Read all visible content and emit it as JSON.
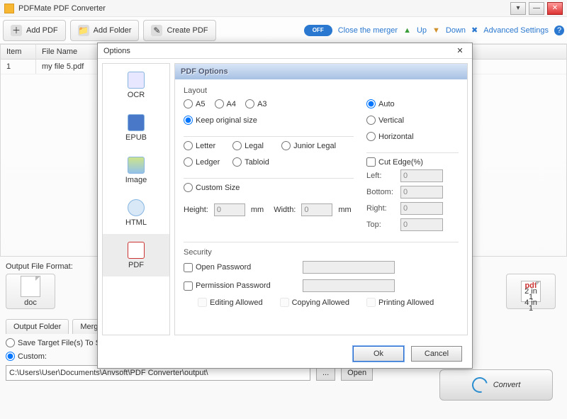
{
  "app": {
    "title": "PDFMate PDF Converter"
  },
  "toolbar": {
    "add_pdf": "Add PDF",
    "add_folder": "Add Folder",
    "create_pdf": "Create PDF",
    "merger_toggle": "OFF",
    "close_merger": "Close the merger",
    "up": "Up",
    "down": "Down",
    "advanced": "Advanced Settings"
  },
  "table": {
    "col_item": "Item",
    "col_file": "File Name",
    "rows": [
      {
        "item": "1",
        "file": "my file  5.pdf"
      }
    ]
  },
  "output_format": {
    "label": "Output File Format:",
    "doc": "doc",
    "pdf_badge": "pdf",
    "pdf_sub1": "2 in 1",
    "pdf_sub2": "4 in 1"
  },
  "output_folder": {
    "tab1": "Output Folder",
    "tab2": "Merge",
    "save_source": "Save Target File(s) To S",
    "custom": "Custom:",
    "path": "C:\\Users\\User\\Documents\\Anvsoft\\PDF Converter\\output\\",
    "browse": "...",
    "open": "Open"
  },
  "convert": "Convert",
  "dialog": {
    "title": "Options",
    "sidebar": {
      "ocr": "OCR",
      "epub": "EPUB",
      "image": "Image",
      "html": "HTML",
      "pdf": "PDF"
    },
    "header": "PDF Options",
    "layout": {
      "label": "Layout",
      "a5": "A5",
      "a4": "A4",
      "a3": "A3",
      "keep": "Keep original size",
      "letter": "Letter",
      "legal": "Legal",
      "junior": "Junior Legal",
      "ledger": "Ledger",
      "tabloid": "Tabloid",
      "custom": "Custom Size",
      "height": "Height:",
      "width": "Width:",
      "h_val": "0",
      "w_val": "0",
      "mm": "mm"
    },
    "orient": {
      "auto": "Auto",
      "vertical": "Vertical",
      "horizontal": "Horizontal"
    },
    "cut": {
      "label": "Cut Edge(%)",
      "left": "Left:",
      "bottom": "Bottom:",
      "right": "Right:",
      "top": "Top:",
      "l": "0",
      "b": "0",
      "r": "0",
      "t": "0"
    },
    "security": {
      "label": "Security",
      "open_pw": "Open Password",
      "perm_pw": "Permission Password",
      "edit": "Editing Allowed",
      "copy": "Copying Allowed",
      "print": "Printing Allowed"
    },
    "ok": "Ok",
    "cancel": "Cancel"
  }
}
